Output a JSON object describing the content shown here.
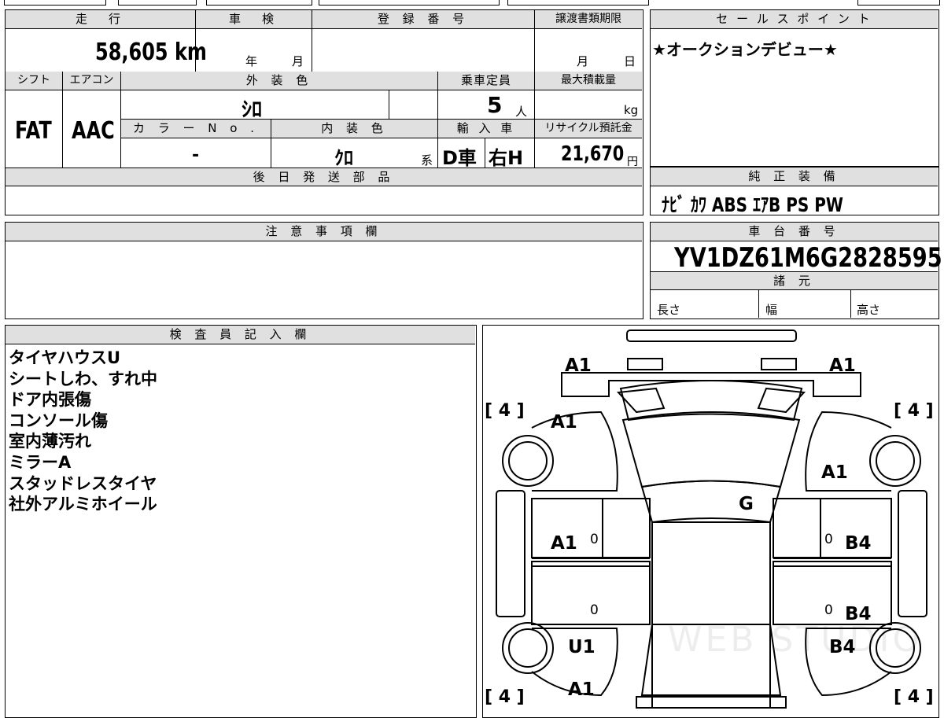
{
  "top": {
    "headers": {
      "mileage": "走　行",
      "inspection": "車　検",
      "registration": "登 録 番 号",
      "transfer_deadline": "譲渡書類期限",
      "selling_point": "セ ー ル ス ポ イ ン ト"
    },
    "mileage": "58,605 km",
    "inspection_year": "年",
    "inspection_month": "月",
    "transfer_month": "月",
    "transfer_day": "日",
    "selling_point": "★オークションデビュー★"
  },
  "row2": {
    "headers": {
      "shift": "シフト",
      "aircon": "エアコン",
      "exterior_color": "外 装 色",
      "capacity": "乗車定員",
      "max_load": "最大積載量",
      "color_no": "カ ラ ー N o .",
      "interior_color": "内 装 色",
      "import": "輸 入 車",
      "recycle": "リサイクル預託金"
    },
    "shift": "FAT",
    "aircon": "AAC",
    "exterior_color": "ｼﾛ",
    "capacity": "5",
    "capacity_unit": "人",
    "max_load_unit": "kg",
    "color_no": "-",
    "interior_color": "ｸﾛ",
    "interior_suffix": "系",
    "import_type": "D車",
    "handle": "右H",
    "recycle_fee": "21,670",
    "recycle_unit": "円"
  },
  "later_parts": {
    "header": "後 日 発 送 部 品",
    "value": ""
  },
  "equipment": {
    "header": "純 正 装 備",
    "value": "ﾅﾋﾞ ｶﾜ ABS ｴｱB PS PW"
  },
  "caution": {
    "header": "注 意 事 項 欄",
    "value": ""
  },
  "chassis": {
    "header": "車 台 番 号",
    "value": "YV1DZ61M6G2828595"
  },
  "specs": {
    "header": "諸 元",
    "length": "長さ",
    "width": "幅",
    "height": "高さ"
  },
  "inspector": {
    "header": "検 査 員 記 入 欄",
    "notes": [
      "タイヤハウスU",
      "シートしわ、すれ中",
      "ドア内張傷",
      "コンソール傷",
      "室内薄汚れ",
      "ミラーA",
      "スタッドレスタイヤ",
      "社外アルミホイール"
    ]
  },
  "diagram": {
    "tire_left_top": "[ 4 ]",
    "tire_right_top": "[ 4 ]",
    "tire_left_bottom": "[ 4 ]",
    "tire_right_bottom": "[ 4 ]",
    "front_left": "A1",
    "front_right": "A1",
    "fender_left_front": "A1",
    "fender_right_front": "A1",
    "roof": "G",
    "door_left_front": "A1",
    "door_right_front": "B4",
    "door_right_rear": "B4",
    "rear_fender_left": "U1",
    "rear_fender_right": "B4",
    "rear_left": "A1",
    "zero_marks": "0",
    "watermark": "WEB STUDIO"
  }
}
